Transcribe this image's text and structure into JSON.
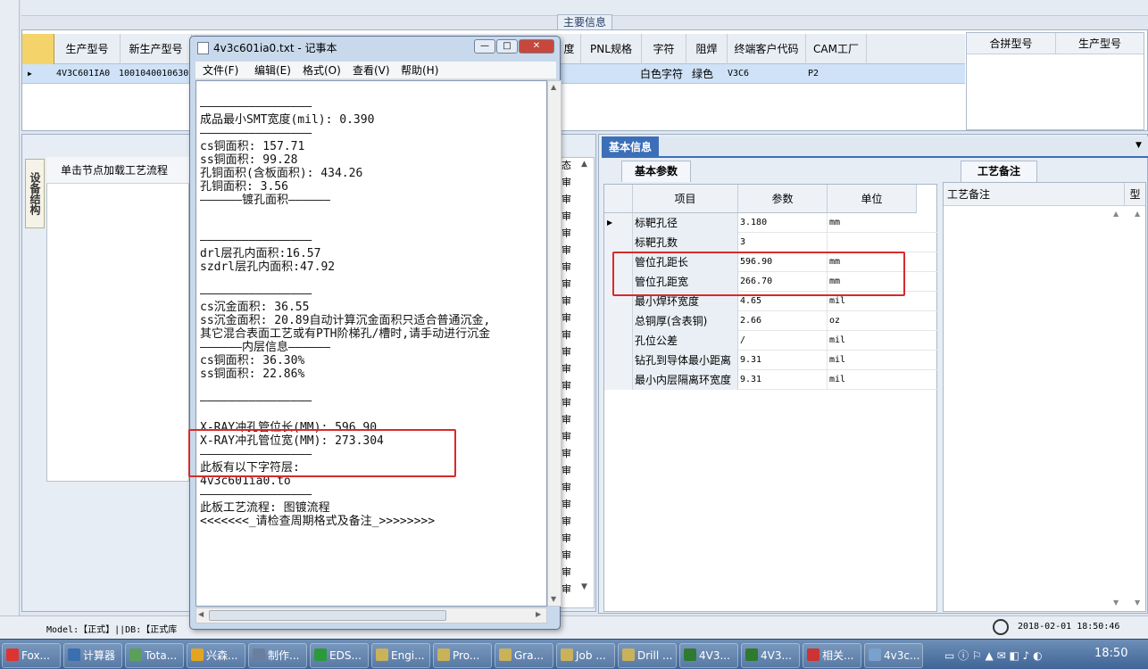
{
  "main_info": {
    "tab_label": "主要信息",
    "columns": [
      "生产型号",
      "新生产型号",
      "度",
      "PNL规格",
      "字符",
      "阻焊",
      "终端客户代码",
      "CAM工厂"
    ],
    "row": {
      "model": "4V3C601IA0",
      "new_model": "1001040010630",
      "char": "白色字符",
      "mask": "绿色",
      "code": "V3C6",
      "factory": "P2"
    },
    "combine_headers": [
      "合拼型号",
      "生产型号"
    ]
  },
  "left_panel": {
    "vertical_tab": "设备结构",
    "flow_header": "单击节点加载工艺流程",
    "status_header": "态",
    "status_items": [
      "审",
      "审",
      "审",
      "审",
      "审",
      "审",
      "审",
      "审",
      "审",
      "审",
      "审",
      "审",
      "审",
      "审",
      "审",
      "审",
      "审",
      "审",
      "审",
      "审",
      "审",
      "审",
      "审",
      "审",
      "审"
    ]
  },
  "basic_info": {
    "header": "基本信息",
    "subtab": "基本参数",
    "table_headers": [
      "项目",
      "参数",
      "单位"
    ],
    "rows": [
      {
        "name": "标靶孔径",
        "value": "3.180",
        "unit": "mm"
      },
      {
        "name": "标靶孔数",
        "value": "3",
        "unit": ""
      },
      {
        "name": "管位孔距长",
        "value": "596.90",
        "unit": "mm"
      },
      {
        "name": "管位孔距宽",
        "value": "266.70",
        "unit": "mm"
      },
      {
        "name": "最小焊环宽度",
        "value": "4.65",
        "unit": "mil"
      },
      {
        "name": "总铜厚(含表铜)",
        "value": "2.66",
        "unit": "oz"
      },
      {
        "name": "孔位公差",
        "value": "/",
        "unit": "mil"
      },
      {
        "name": "钻孔到导体最小距离",
        "value": "9.31",
        "unit": "mil"
      },
      {
        "name": "最小内层隔离环宽度",
        "value": "9.31",
        "unit": "mil"
      }
    ]
  },
  "notes": {
    "tab": "工艺备注",
    "header": "工艺备注",
    "type_header": "型"
  },
  "status_bar": {
    "model_text": "Model:【正式】||DB:【正式库",
    "datetime": "2018-02-01 18:50:46"
  },
  "notepad": {
    "title": "4v3c601ia0.txt - 记事本",
    "menu": [
      "文件(F)",
      "编辑(E)",
      "格式(O)",
      "查看(V)",
      "帮助(H)"
    ],
    "lines": [
      "",
      "————————————————",
      "成品最小SMT宽度(mil): 0.390",
      "————————————————",
      "cs铜面积: 157.71",
      "ss铜面积: 99.28",
      "孔铜面积(含板面积): 434.26",
      "孔铜面积: 3.56",
      "——————镀孔面积——————",
      "",
      "",
      "————————————————",
      "drl层孔内面积:16.57",
      "szdrl层孔内面积:47.92",
      "",
      "————————————————",
      "cs沉金面积: 36.55",
      "ss沉金面积: 20.89自动计算沉金面积只适合普通沉金,",
      "其它混合表面工艺或有PTH阶梯孔/槽时,请手动进行沉金",
      "——————内层信息——————",
      "cs铜面积: 36.30%",
      "ss铜面积: 22.86%",
      "",
      "————————————————",
      "",
      "X-RAY冲孔管位长(MM): 596.90",
      "X-RAY冲孔管位宽(MM): 273.304",
      "————————————————",
      "此板有以下字符层:",
      "4v3c601ia0.to",
      "————————————————",
      "此板工艺流程: 图镀流程",
      "<<<<<<<_请检查周期格式及备注_>>>>>>>>"
    ]
  },
  "taskbar": {
    "items": [
      "Fox...",
      "计算器",
      "Tota...",
      "兴森...",
      "制作...",
      "EDS...",
      "Engi...",
      "Pro...",
      "Gra...",
      "Job ...",
      "Drill ...",
      "4V3...",
      "4V3...",
      "相关...",
      "4v3c..."
    ],
    "clock": "18:50"
  }
}
